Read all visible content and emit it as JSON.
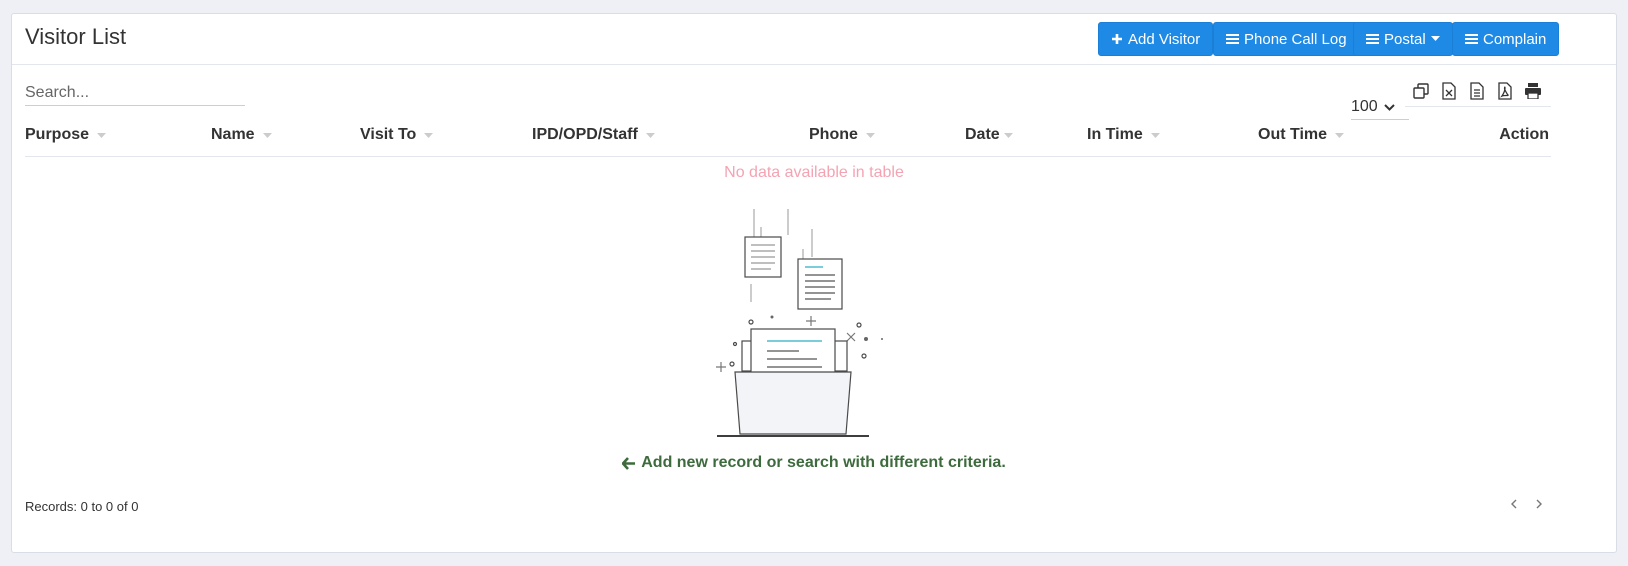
{
  "title": "Visitor List",
  "header_buttons": {
    "add_visitor": "Add Visitor",
    "phone_call_log": "Phone Call Log",
    "postal": "Postal",
    "complain": "Complain"
  },
  "search": {
    "placeholder": "Search...",
    "value": ""
  },
  "page_size": "100",
  "export_tools": [
    "copy-icon",
    "excel-icon",
    "csv-icon",
    "pdf-icon",
    "print-icon"
  ],
  "columns": [
    "Purpose",
    "Name",
    "Visit To",
    "IPD/OPD/Staff",
    "Phone",
    "Date",
    "In Time",
    "Out Time",
    "Action"
  ],
  "empty_message": "No data available in table",
  "hint": "Add new record or search with different criteria.",
  "records_text": "Records: 0 to 0 of 0",
  "colors": {
    "primary_button": "#1e8ae6",
    "empty_text": "#f4a3b2",
    "hint_text": "#3d6b3d"
  }
}
